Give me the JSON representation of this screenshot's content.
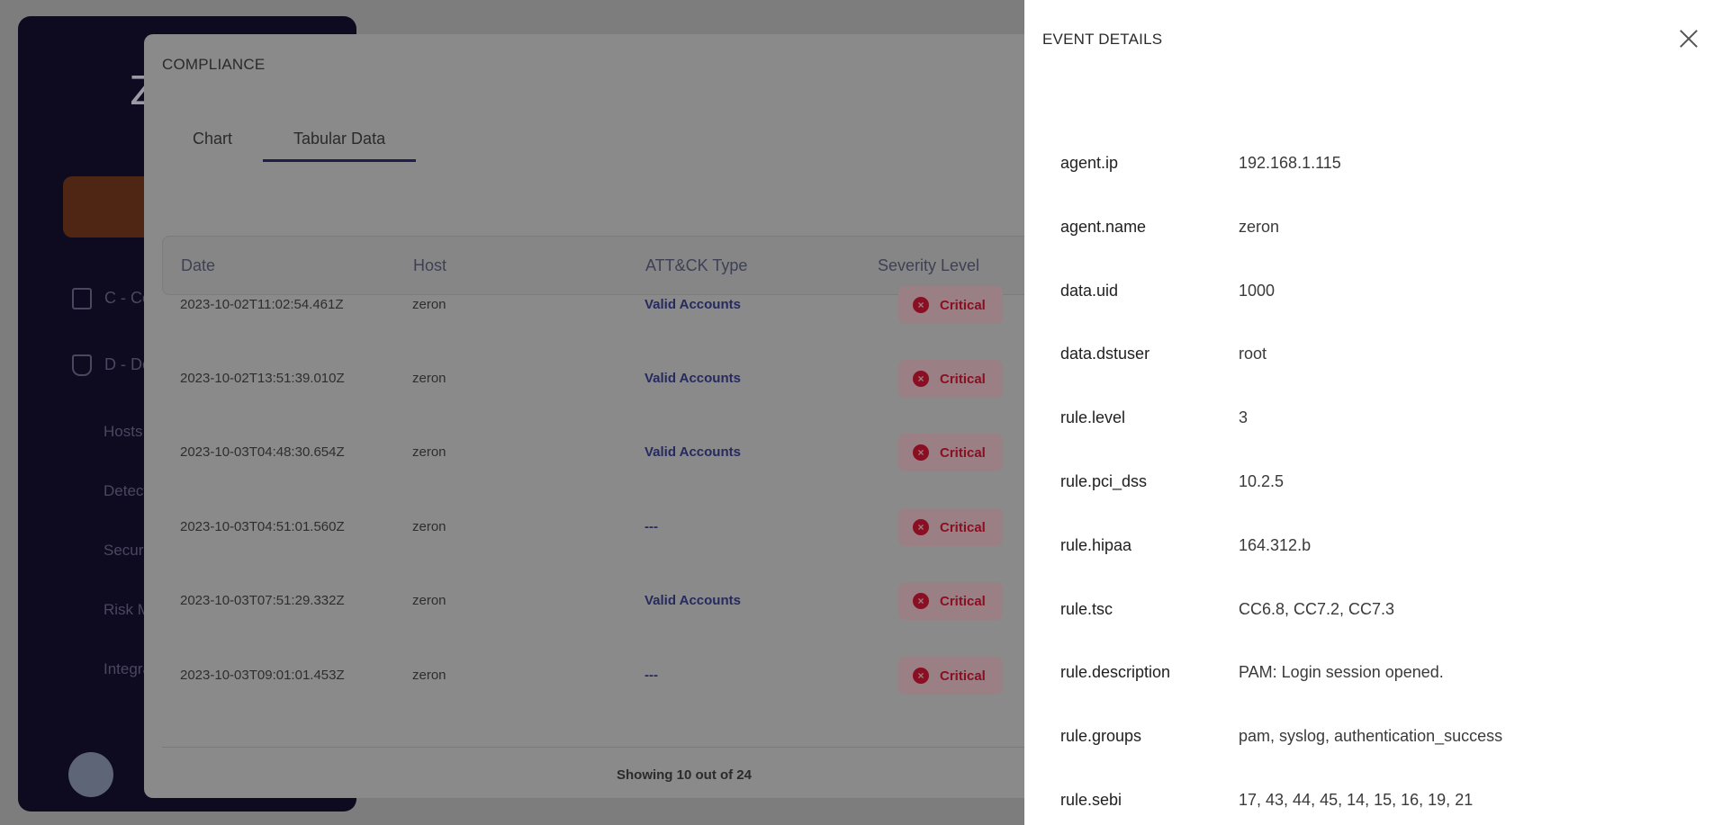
{
  "modal": {
    "title": "COMPLIANCE",
    "tabs": [
      {
        "label": "Chart",
        "active": false
      },
      {
        "label": "Tabular Data",
        "active": true
      }
    ],
    "columns": [
      "Date",
      "Host",
      "ATT&CK Type",
      "Severity Level"
    ],
    "rows": [
      {
        "date": "2023-10-02T11:02:54.461Z",
        "host": "zeron",
        "attack_type": "Valid Accounts",
        "severity": "Critical"
      },
      {
        "date": "2023-10-02T13:51:39.010Z",
        "host": "zeron",
        "attack_type": "Valid Accounts",
        "severity": "Critical"
      },
      {
        "date": "2023-10-03T04:48:30.654Z",
        "host": "zeron",
        "attack_type": "Valid Accounts",
        "severity": "Critical"
      },
      {
        "date": "2023-10-03T04:51:01.560Z",
        "host": "zeron",
        "attack_type": "---",
        "severity": "Critical"
      },
      {
        "date": "2023-10-03T07:51:29.332Z",
        "host": "zeron",
        "attack_type": "Valid Accounts",
        "severity": "Critical"
      },
      {
        "date": "2023-10-03T09:01:01.453Z",
        "host": "zeron",
        "attack_type": "---",
        "severity": "Critical"
      }
    ],
    "footer": "Showing 10 out of 24"
  },
  "drawer": {
    "title": "EVENT DETAILS",
    "fields": [
      {
        "key": "agent.ip",
        "value": "192.168.1.115"
      },
      {
        "key": "agent.name",
        "value": "zeron"
      },
      {
        "key": "data.uid",
        "value": "1000"
      },
      {
        "key": "data.dstuser",
        "value": "root"
      },
      {
        "key": "rule.level",
        "value": "3"
      },
      {
        "key": "rule.pci_dss",
        "value": "10.2.5"
      },
      {
        "key": "rule.hipaa",
        "value": "164.312.b"
      },
      {
        "key": "rule.tsc",
        "value": "CC6.8, CC7.2, CC7.3"
      },
      {
        "key": "rule.description",
        "value": "PAM: Login session opened."
      },
      {
        "key": "rule.groups",
        "value": "pam, syslog, authentication_success"
      },
      {
        "key": "rule.sebi",
        "value": "17, 43, 44, 45, 14, 15, 16, 19, 21"
      }
    ]
  },
  "background": {
    "logo": "Z",
    "nav": [
      "C - Com",
      "D - Defe"
    ],
    "subnav": [
      "Hosts",
      "Detectio",
      "Security",
      "Risk Ma",
      "Integrat"
    ]
  },
  "colors": {
    "critical": "#8a0f22",
    "tab_underline": "#1c1f4a",
    "sidebar": "#0e0a1f"
  }
}
